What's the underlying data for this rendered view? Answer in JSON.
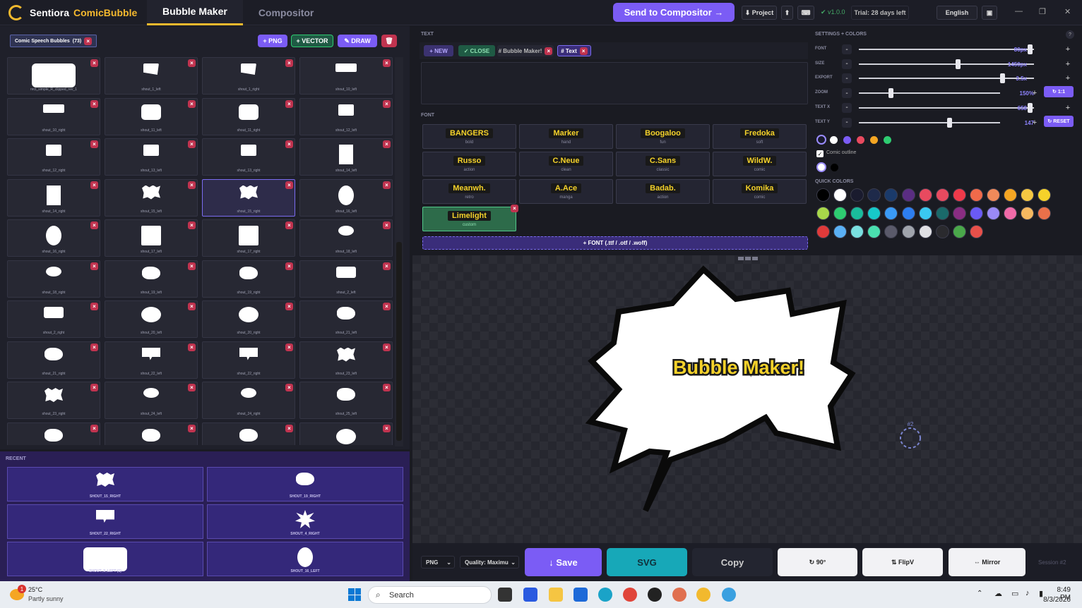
{
  "app": {
    "name": "Sentiora",
    "product": "ComicBubble"
  },
  "nav": {
    "tab_bubble_maker": "Bubble Maker",
    "tab_compositor": "Compositor"
  },
  "top": {
    "send_label": "Send to Compositor →",
    "project_label": "⬇ Project",
    "upload_icon": "⬆",
    "keyboard_icon": "⌨",
    "version": "✔ v1.0.0",
    "trial": "Trial: 28 days left",
    "language": "English",
    "book_icon": "▣",
    "minimize": "—",
    "maximize": "❐",
    "close": "✕"
  },
  "library": {
    "category": "Comic Speech Bubbles",
    "count": "(73)",
    "png_label": "+ PNG",
    "vector_label": "+ VECTOR",
    "draw_label": "✎ DRAW",
    "trash_icon": "🗑",
    "items": [
      {
        "label": "rect_simple_R_clipped_rev_1",
        "shape": "round-rect-wide"
      },
      {
        "label": "shout_1_left",
        "shape": "flag"
      },
      {
        "label": "shout_1_right",
        "shape": "flag"
      },
      {
        "label": "shout_10_left",
        "shape": "wide"
      },
      {
        "label": "shout_10_right",
        "shape": "wide"
      },
      {
        "label": "shout_11_left",
        "shape": "round-rect"
      },
      {
        "label": "shout_11_right",
        "shape": "round-rect"
      },
      {
        "label": "shout_12_left",
        "shape": "small-rect"
      },
      {
        "label": "shout_12_right",
        "shape": "small-rect"
      },
      {
        "label": "shout_13_left",
        "shape": "small-rect"
      },
      {
        "label": "shout_13_right",
        "shape": "small-rect"
      },
      {
        "label": "shout_14_left",
        "shape": "tall"
      },
      {
        "label": "shout_14_right",
        "shape": "tall"
      },
      {
        "label": "shout_15_left",
        "shape": "spiky"
      },
      {
        "label": "shout_15_right",
        "shape": "spiky"
      },
      {
        "label": "shout_16_left",
        "shape": "oval-tall"
      },
      {
        "label": "shout_16_right",
        "shape": "oval-tall"
      },
      {
        "label": "shout_17_left",
        "shape": "square"
      },
      {
        "label": "shout_17_right",
        "shape": "square"
      },
      {
        "label": "shout_18_left",
        "shape": "ellipse-small"
      },
      {
        "label": "shout_18_right",
        "shape": "ellipse-small"
      },
      {
        "label": "shout_19_left",
        "shape": "cloud"
      },
      {
        "label": "shout_19_right",
        "shape": "cloud"
      },
      {
        "label": "shout_2_left",
        "shape": "stack"
      },
      {
        "label": "shout_2_right",
        "shape": "stack"
      },
      {
        "label": "shout_20_left",
        "shape": "ellipse"
      },
      {
        "label": "shout_20_right",
        "shape": "ellipse"
      },
      {
        "label": "shout_21_left",
        "shape": "cloud"
      },
      {
        "label": "shout_21_right",
        "shape": "cloud"
      },
      {
        "label": "shout_22_left",
        "shape": "speech"
      },
      {
        "label": "shout_22_right",
        "shape": "speech"
      },
      {
        "label": "shout_23_left",
        "shape": "spiky"
      },
      {
        "label": "shout_23_right",
        "shape": "spiky"
      },
      {
        "label": "shout_24_left",
        "shape": "ellipse-small"
      },
      {
        "label": "shout_24_right",
        "shape": "ellipse-small"
      },
      {
        "label": "shout_25_left",
        "shape": "cloud"
      },
      {
        "label": "",
        "shape": "cloud"
      },
      {
        "label": "",
        "shape": "cloud"
      },
      {
        "label": "",
        "shape": "cloud"
      },
      {
        "label": "",
        "shape": "ellipse"
      }
    ],
    "selected_index": 14
  },
  "recent": {
    "title": "RECENT",
    "items": [
      {
        "label": "SHOUT_15_RIGHT",
        "shape": "spiky"
      },
      {
        "label": "SHOUT_19_RIGHT",
        "shape": "cloud"
      },
      {
        "label": "SHOUT_22_RIGHT",
        "shape": "speech"
      },
      {
        "label": "SHOUT_4_RIGHT",
        "shape": "burst"
      },
      {
        "label": "SHOUT_5_LEFT (1)",
        "shape": "round-rect-wide"
      },
      {
        "label": "SHOUT_16_LEFT",
        "shape": "oval-tall"
      }
    ]
  },
  "text_section": {
    "title": "TEXT",
    "new_label": "+ NEW",
    "close_label": "✓ CLOSE",
    "tab1": "# Bubble Maker!",
    "tab2": "# Text"
  },
  "font_section": {
    "title": "FONT",
    "fonts": [
      {
        "name": "BANGERS",
        "style": "bold"
      },
      {
        "name": "Marker",
        "style": "hand"
      },
      {
        "name": "Boogaloo",
        "style": "fun"
      },
      {
        "name": "Fredoka",
        "style": "soft"
      },
      {
        "name": "Russo",
        "style": "action"
      },
      {
        "name": "C.Neue",
        "style": "clean"
      },
      {
        "name": "C.Sans",
        "style": "classic"
      },
      {
        "name": "WildW.",
        "style": "comic"
      },
      {
        "name": "Meanwh.",
        "style": "retro"
      },
      {
        "name": "A.Ace",
        "style": "manga"
      },
      {
        "name": "Badab.",
        "style": "action"
      },
      {
        "name": "Komika",
        "style": "comic"
      },
      {
        "name": "Limelight",
        "style": "custom"
      }
    ],
    "add_font_label": "+ FONT (.ttf / .otf / .woff)"
  },
  "settings": {
    "title": "SETTINGS + COLORS",
    "help_icon": "?",
    "rows": [
      {
        "label": "FONT",
        "value": "80px",
        "level": 0.99
      },
      {
        "label": "SIZE",
        "value": "1450px",
        "level": 0.57
      },
      {
        "label": "EXPORT",
        "value": "3.5x",
        "level": 0.83
      },
      {
        "label": "ZOOM",
        "value": "150%",
        "level": 0.22,
        "button": "↻ 1:1"
      },
      {
        "label": "TEXT X",
        "value": "658",
        "level": 0.99
      },
      {
        "label": "TEXT Y",
        "value": "147",
        "level": 0.65,
        "button": "↻ RESET"
      }
    ],
    "fill_colors": [
      "#1a1b2e",
      "#ffffff",
      "#7b5cf5",
      "#e84a5f",
      "#f5a623",
      "#2ecc71"
    ],
    "comic_outline_label": "Comic outline",
    "outline_colors": [
      "#ffffff",
      "#000000"
    ],
    "quick_colors_title": "QUICK COLORS",
    "quick_colors": [
      "#000000",
      "#ffffff",
      "#1a1b2e",
      "#1e2a4a",
      "#1a3a6a",
      "#5a2d82",
      "#e84a5f",
      "#e84a5f",
      "#ee3a4a",
      "#f06a4a",
      "#f08a5a",
      "#f5a623",
      "#f5c842",
      "#f5d22a",
      "#a8d84a",
      "#2ecc71",
      "#1abc9c",
      "#17c9c9",
      "#3a9af5",
      "#2d7ef0",
      "#3ac8f0",
      "#1a6a6a",
      "#8a2d82",
      "#6a5af5",
      "#9a8af5",
      "#f06aa8",
      "#f5b860",
      "#e8704a",
      "#e03a3a",
      "#5ab0f5",
      "#7ae0e0",
      "#4ae0b0",
      "#5a5a6a",
      "#a0a4ac",
      "#e0e0e4",
      "#2a2a2e",
      "#4aa84a",
      "#e8504a"
    ]
  },
  "canvas": {
    "bubble_text": "Bubble Maker!",
    "marker_label": "#2"
  },
  "bottom": {
    "format": "PNG",
    "quality": "Quality: Maximu",
    "save": "↓ Save",
    "svg": "SVG",
    "copy": "Copy",
    "rotate": "↻ 90°",
    "flipv": "⇅ FlipV",
    "mirror": "⇔ Mirror",
    "session": "Session #2"
  },
  "taskbar": {
    "temp": "25°C",
    "weather": "Partly sunny",
    "badge": "1",
    "search": "Search",
    "time": "8:49 PM",
    "date": "8/3/2026"
  }
}
